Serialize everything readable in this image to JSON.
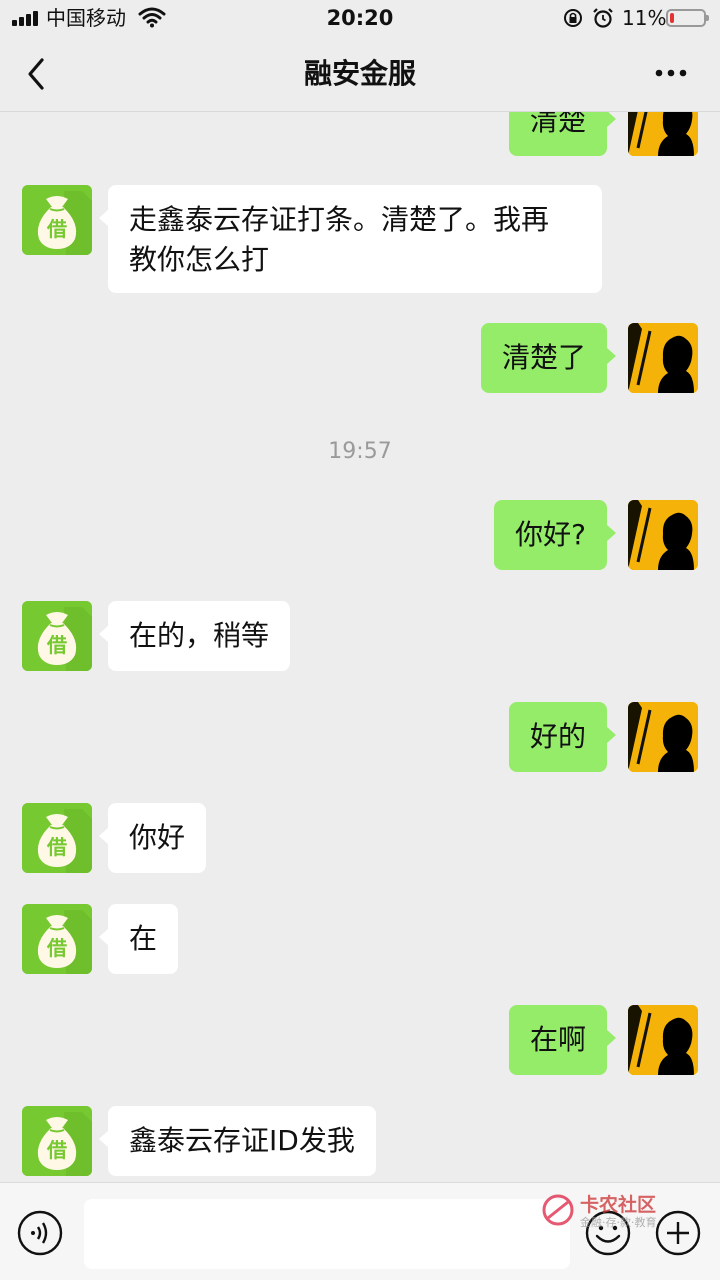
{
  "status_bar": {
    "carrier": "中国移动",
    "time": "20:20",
    "battery_percent": "11%",
    "battery_level": 0.11,
    "battery_color": "#e33333"
  },
  "nav": {
    "title": "融安金服",
    "back_icon": "chevron-left-icon",
    "more_icon": "more-dots-icon"
  },
  "avatars": {
    "contact_label": "借",
    "contact_color": "#77c931",
    "me_color": "#f5b30a"
  },
  "messages": [
    {
      "side": "out",
      "text": "清楚"
    },
    {
      "side": "in",
      "text": "走鑫泰云存证打条。清楚了。我再\n教你怎么打"
    },
    {
      "side": "out",
      "text": "清楚了"
    },
    {
      "side": "time",
      "text": "19:57"
    },
    {
      "side": "out",
      "text": "你好?"
    },
    {
      "side": "in",
      "text": "在的，稍等"
    },
    {
      "side": "out",
      "text": "好的"
    },
    {
      "side": "in",
      "text": "你好"
    },
    {
      "side": "in",
      "text": "在"
    },
    {
      "side": "out",
      "text": "在啊"
    },
    {
      "side": "in",
      "text": "鑫泰云存证ID发我"
    }
  ],
  "input_bar": {
    "voice_icon": "voice-icon",
    "emoji_icon": "emoji-icon",
    "plus_icon": "plus-icon",
    "input_value": ""
  },
  "watermark": {
    "title": "卡农社区",
    "subtitle": "金融·存·款·教育"
  }
}
